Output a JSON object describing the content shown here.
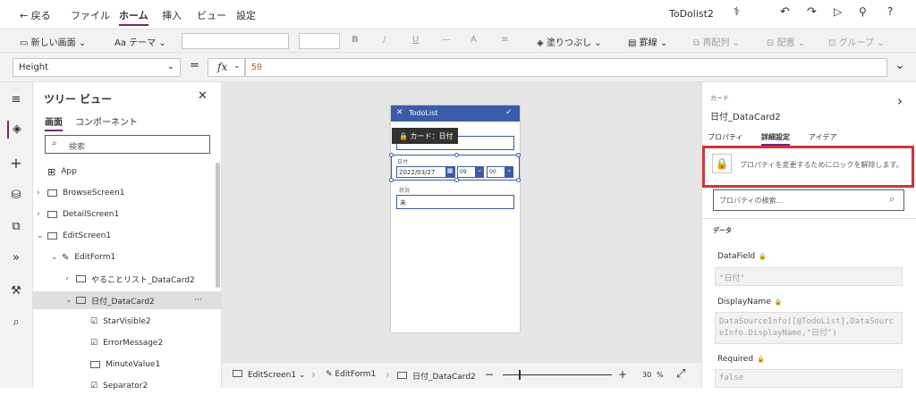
{
  "menubar": {
    "back": "戻る",
    "file": "ファイル",
    "home": "ホーム",
    "insert": "挿入",
    "view": "ビュー",
    "settings": "設定",
    "app_name": "ToDolist2"
  },
  "ribbon": {
    "new_screen": "新しい画面",
    "theme": "テーマ",
    "bold": "B",
    "italic": "/",
    "underline": "U",
    "strike": "—",
    "font_color": "A",
    "align": "≡",
    "fill": "塗りつぶし",
    "border": "罫線",
    "reorder": "再配列",
    "arrange": "配置",
    "group": "グループ"
  },
  "formula": {
    "property": "Height",
    "equals": "=",
    "fx": "fx",
    "value": "50"
  },
  "tree": {
    "title": "ツリー ビュー",
    "tab_screens": "画面",
    "tab_components": "コンポーネント",
    "search_placeholder": "検索",
    "app": "App",
    "nodes": [
      "BrowseScreen1",
      "DetailScreen1",
      "EditScreen1",
      "EditForm1",
      "やることリスト_DataCard2",
      "日付_DataCard2",
      "StarVisible2",
      "ErrorMessage2",
      "MinuteValue1",
      "Separator2"
    ],
    "more": "···"
  },
  "phone": {
    "title": "TodoList",
    "tooltip": "カード：日付",
    "date_label": "日付",
    "date_value": "2022/03/27",
    "hour": "09",
    "minute": "00",
    "status_label": "状況",
    "status_value": "未"
  },
  "status": {
    "screen": "EditScreen1",
    "form": "EditForm1",
    "card": "日付_DataCard2",
    "minus": "−",
    "plus": "+",
    "zoom": "30",
    "zoom_unit": "%"
  },
  "rpanel": {
    "type": "カード",
    "name": "日付_DataCard2",
    "tabs": [
      "プロパティ",
      "詳細設定",
      "アイデア"
    ],
    "unlock_text": "プロパティを変更するためにロックを解除します。",
    "search_placeholder": "プロパティの検索...",
    "section": "データ",
    "datafield_label": "DataField",
    "datafield_value": "\"日付\"",
    "displayname_label": "DisplayName",
    "displayname_value": "DataSourceInfo([@TodoList],DataSourceInfo.DisplayName,\"日付\")",
    "required_label": "Required",
    "required_value": "false"
  },
  "colors": {
    "accent": "#742774",
    "phone_header": "#3b5bab",
    "highlight": "#d13438"
  }
}
